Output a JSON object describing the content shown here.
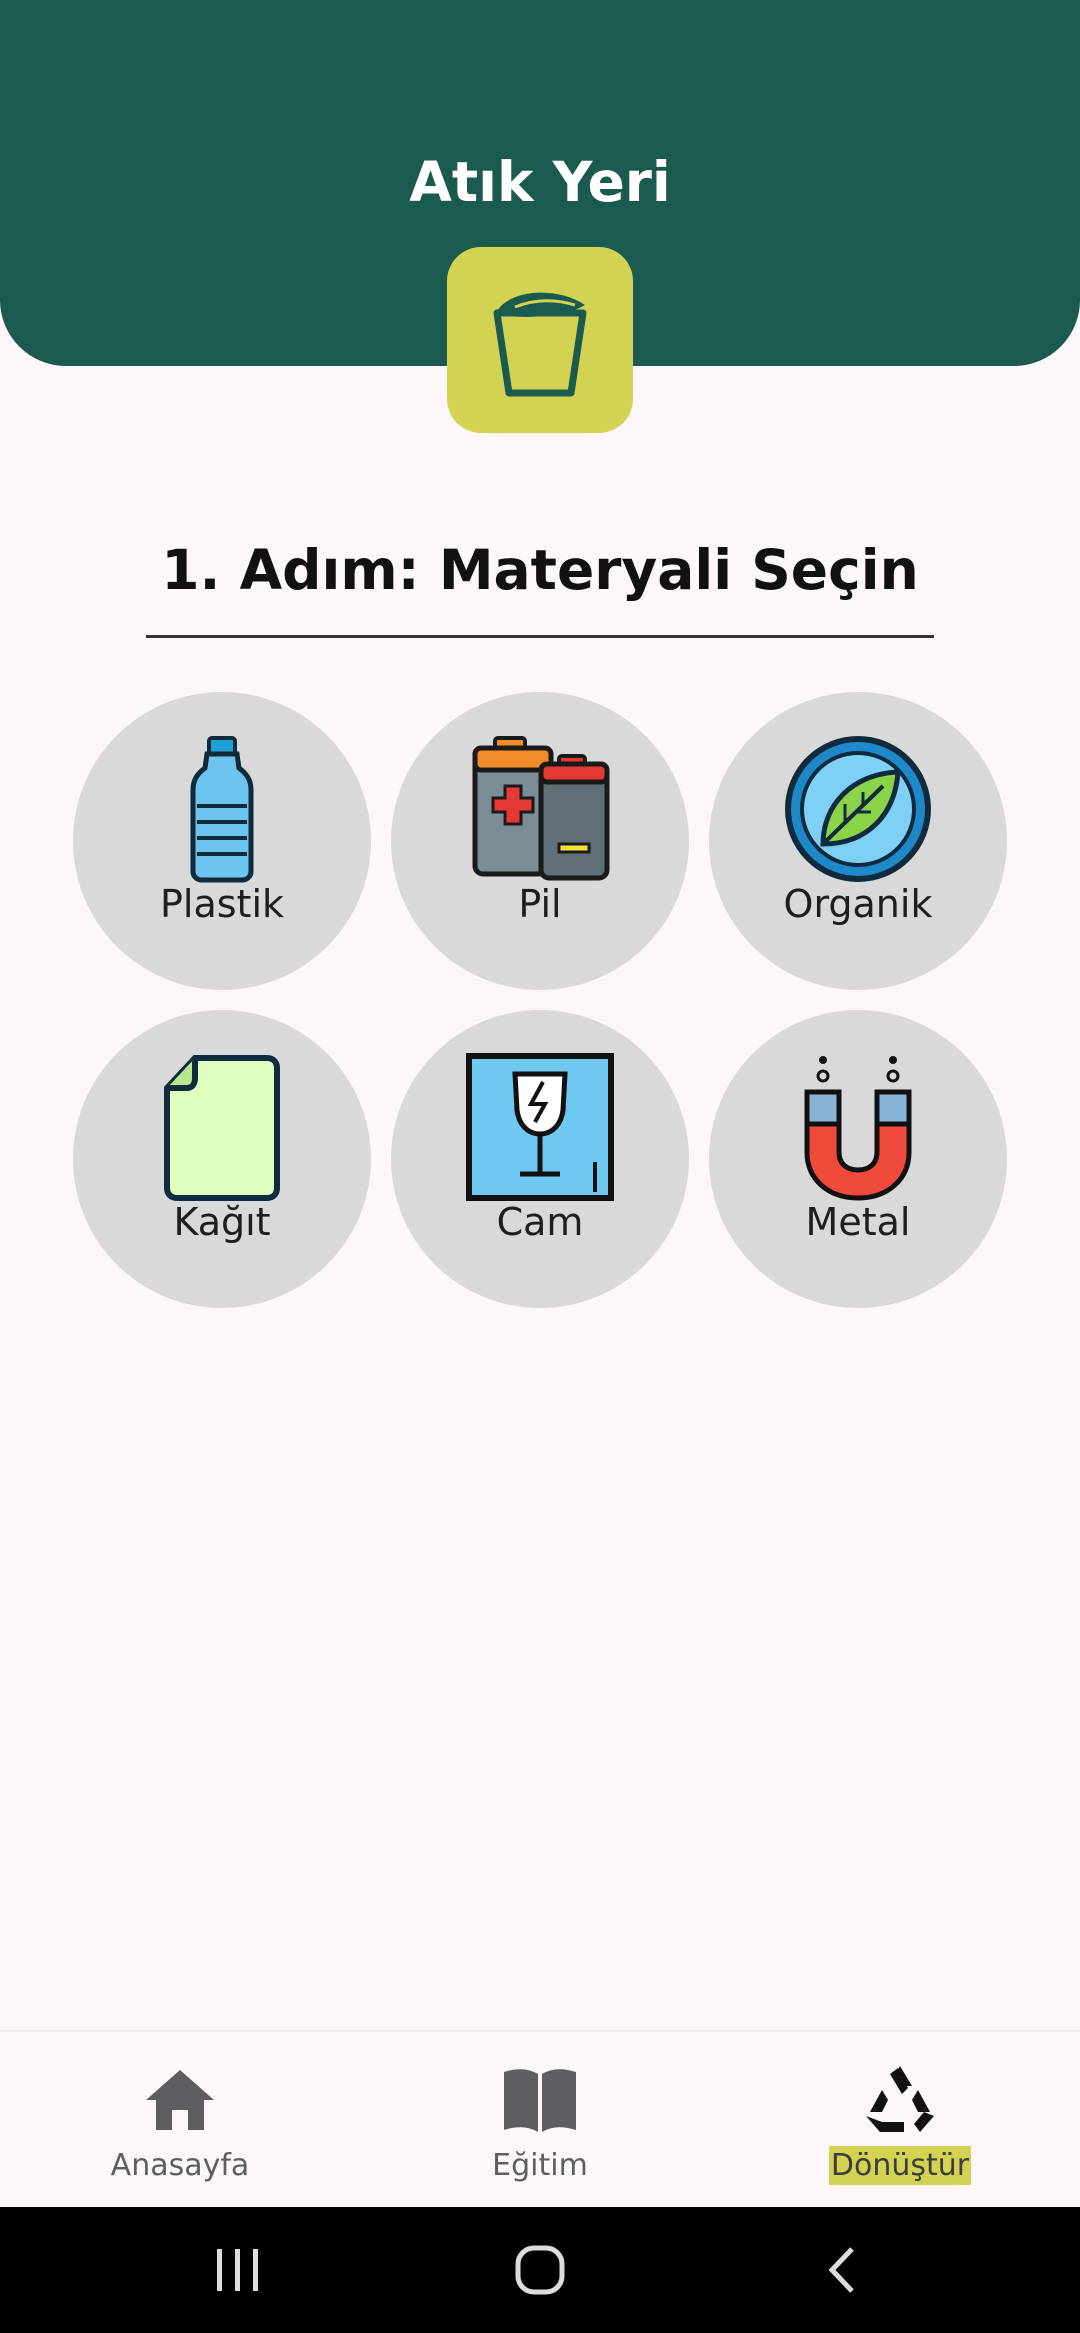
{
  "header": {
    "title": "Atık Yeri",
    "logo_icon": "recycle-bin-leaf-icon"
  },
  "step": {
    "title": "1. Adım: Materyali Seçin"
  },
  "materials": [
    {
      "label": "Plastik",
      "icon": "plastic-bottle-icon"
    },
    {
      "label": "Pil",
      "icon": "battery-icon"
    },
    {
      "label": "Organik",
      "icon": "leaf-icon"
    },
    {
      "label": "Kağıt",
      "icon": "paper-icon"
    },
    {
      "label": "Cam",
      "icon": "glass-icon"
    },
    {
      "label": "Metal",
      "icon": "magnet-icon"
    }
  ],
  "nav": {
    "items": [
      {
        "label": "Anasayfa",
        "icon": "home-icon",
        "active": false
      },
      {
        "label": "Eğitim",
        "icon": "book-icon",
        "active": false
      },
      {
        "label": "Dönüştür",
        "icon": "recycle-icon",
        "active": true
      }
    ]
  },
  "colors": {
    "header_bg": "#1b5a4e",
    "accent": "#d2d353",
    "circle_bg": "#d9d9d9",
    "page_bg": "#fdf7fc"
  }
}
